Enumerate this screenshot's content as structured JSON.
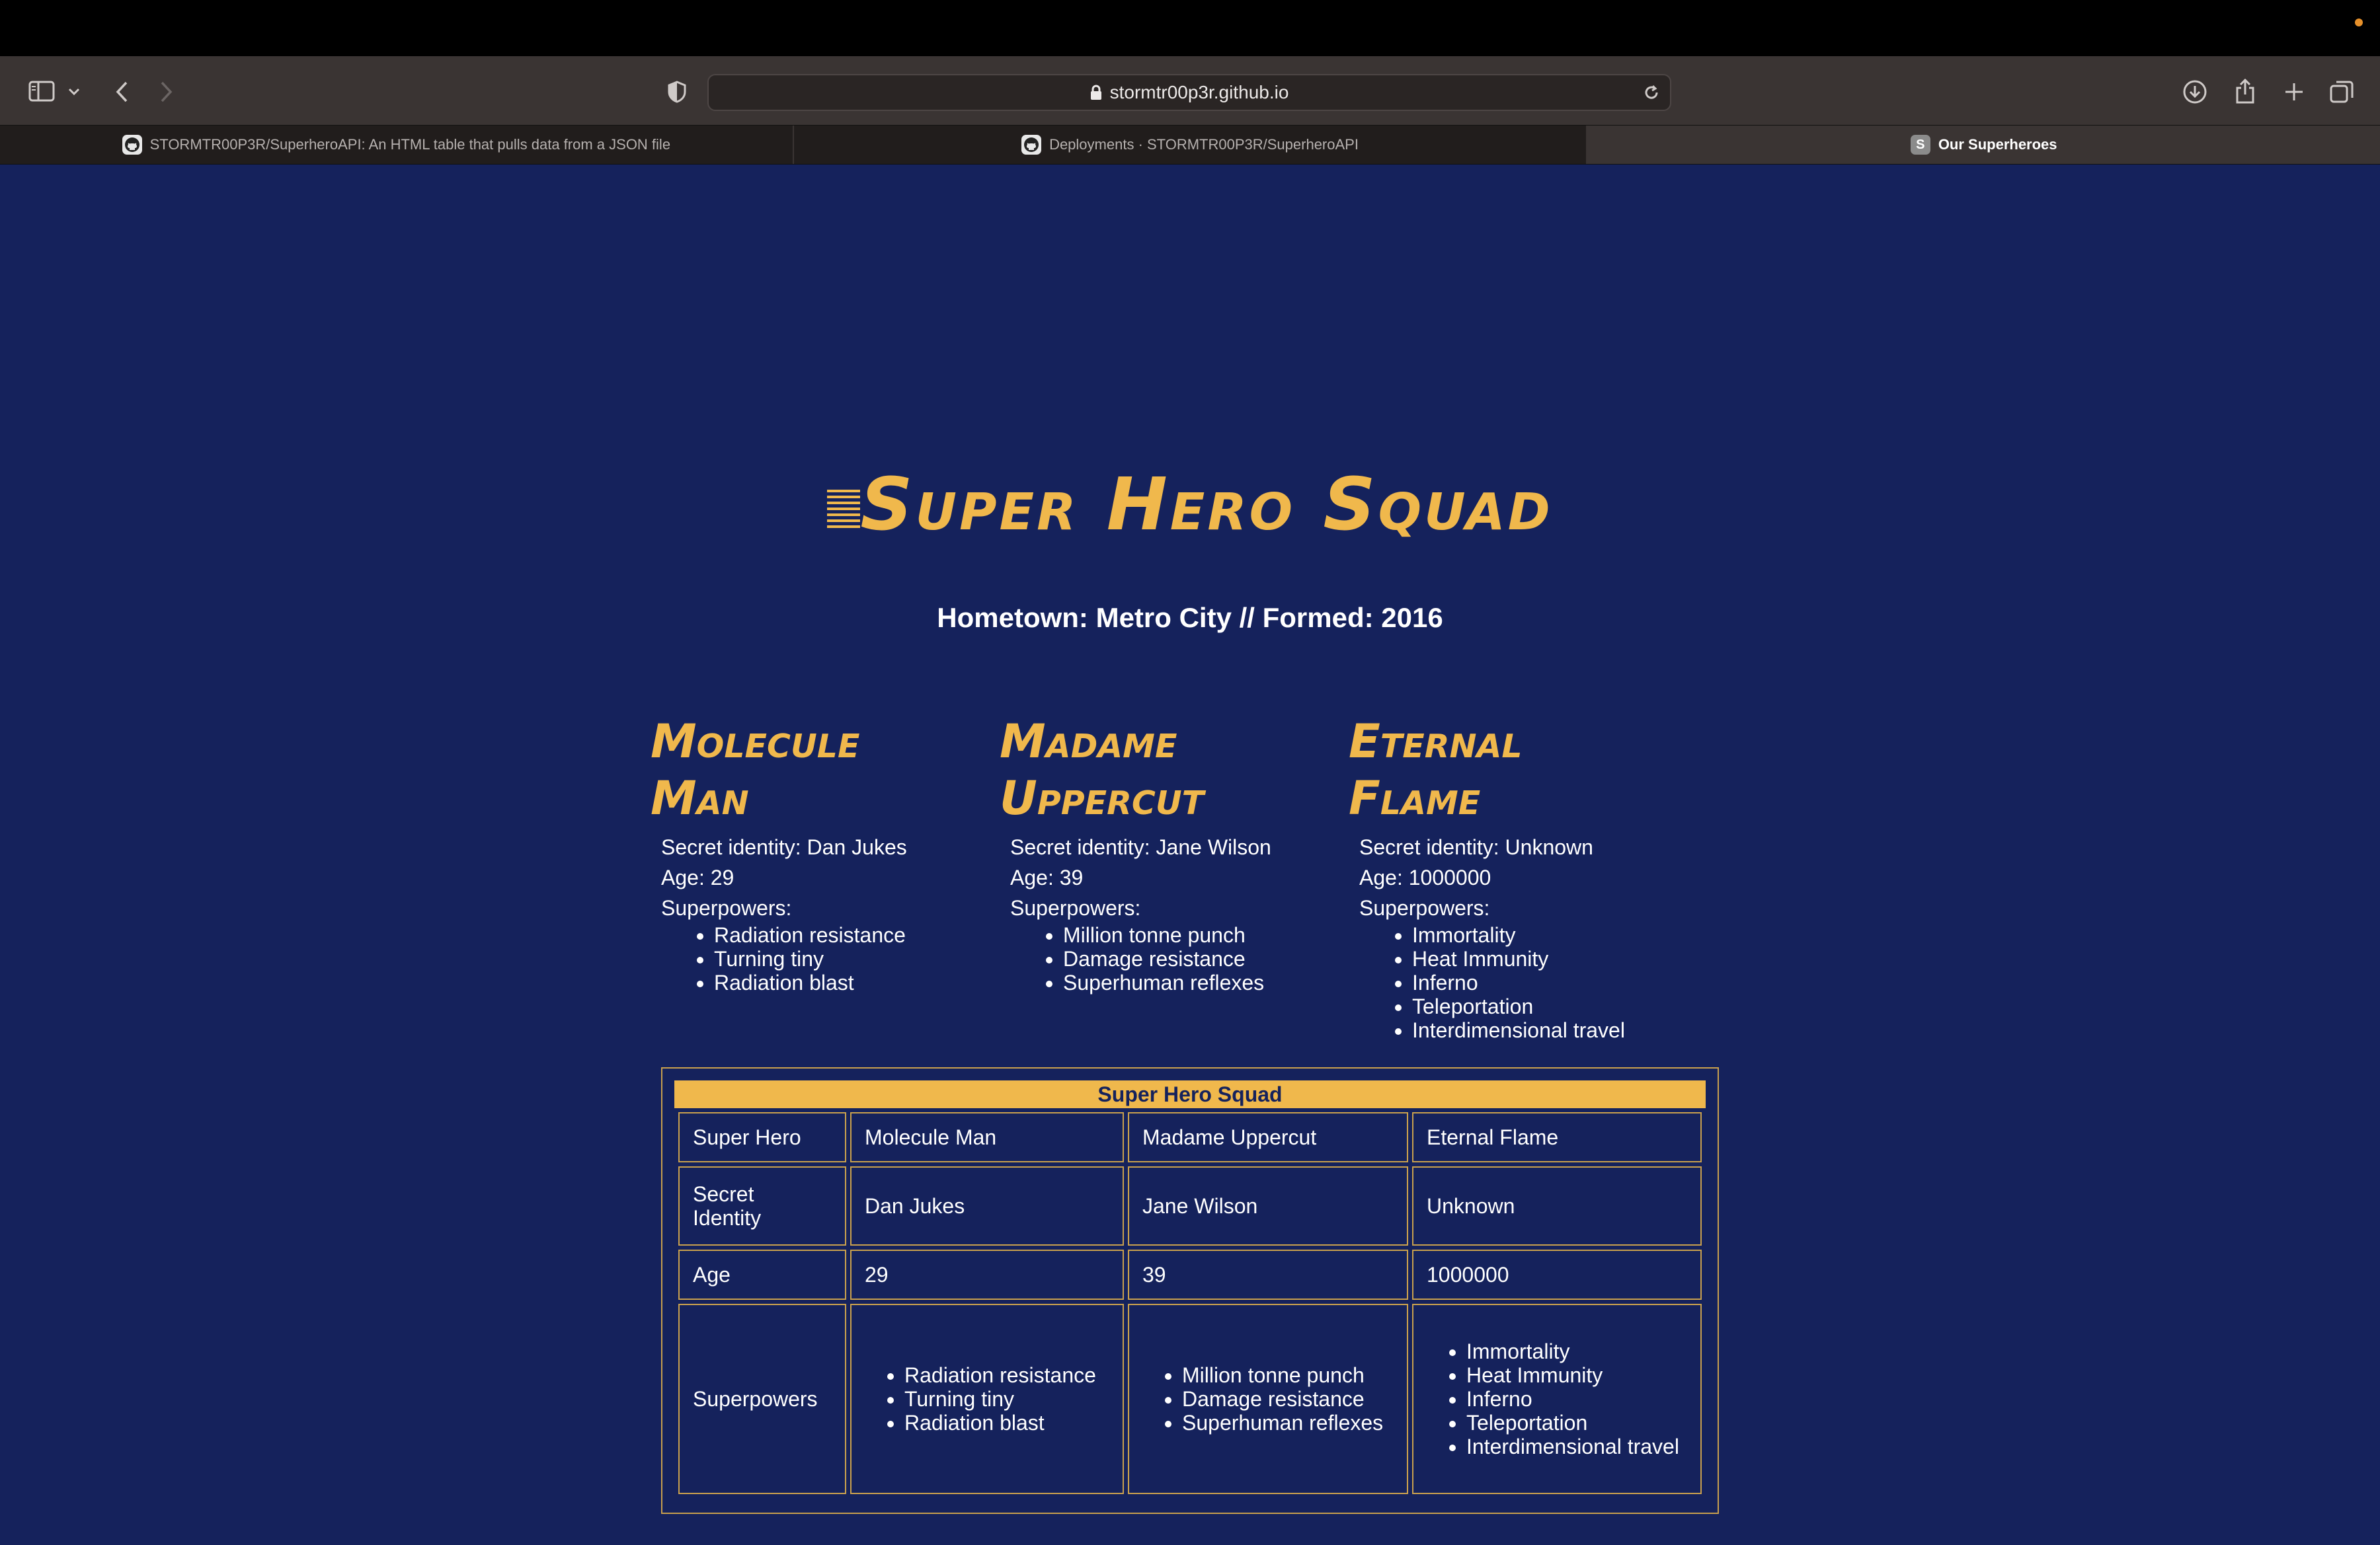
{
  "browser": {
    "url": "stormtr00p3r.github.io",
    "tabs": [
      {
        "label": "STORMTR00P3R/SuperheroAPI: An HTML table that pulls data from a JSON file",
        "favicon": "github-icon",
        "active": false
      },
      {
        "label": "Deployments · STORMTR00P3R/SuperheroAPI",
        "favicon": "github-icon",
        "active": false
      },
      {
        "label": "Our Superheroes",
        "favicon": "S",
        "active": true
      }
    ]
  },
  "page": {
    "title": "Super Hero Squad",
    "subtitle": "Hometown: Metro City // Formed: 2016",
    "accent_color": "#f0b84c",
    "background_color": "#15225c",
    "heroes": [
      {
        "name_line1": "Molecule",
        "name_line2": "Man",
        "secret_identity": "Secret identity: Dan Jukes",
        "age": "Age: 29",
        "powers_label": "Superpowers:",
        "powers": [
          "Radiation resistance",
          "Turning tiny",
          "Radiation blast"
        ]
      },
      {
        "name_line1": "Madame",
        "name_line2": "Uppercut",
        "secret_identity": "Secret identity: Jane Wilson",
        "age": "Age: 39",
        "powers_label": "Superpowers:",
        "powers": [
          "Million tonne punch",
          "Damage resistance",
          "Superhuman reflexes"
        ]
      },
      {
        "name_line1": "Eternal",
        "name_line2": "Flame",
        "secret_identity": "Secret identity: Unknown",
        "age": "Age: 1000000",
        "powers_label": "Superpowers:",
        "powers": [
          "Immortality",
          "Heat Immunity",
          "Inferno",
          "Teleportation",
          "Interdimensional travel"
        ]
      }
    ],
    "table": {
      "caption": "Super Hero Squad",
      "row_headers": [
        "Super Hero",
        "Secret Identity",
        "Age",
        "Superpowers"
      ],
      "columns": [
        {
          "name": "Molecule Man",
          "identity": "Dan Jukes",
          "age": "29",
          "powers": [
            "Radiation resistance",
            "Turning tiny",
            "Radiation blast"
          ]
        },
        {
          "name": "Madame Uppercut",
          "identity": "Jane Wilson",
          "age": "39",
          "powers": [
            "Million tonne punch",
            "Damage resistance",
            "Superhuman reflexes"
          ]
        },
        {
          "name": "Eternal Flame",
          "identity": "Unknown",
          "age": "1000000",
          "powers": [
            "Immortality",
            "Heat Immunity",
            "Inferno",
            "Teleportation",
            "Interdimensional travel"
          ]
        }
      ]
    }
  }
}
